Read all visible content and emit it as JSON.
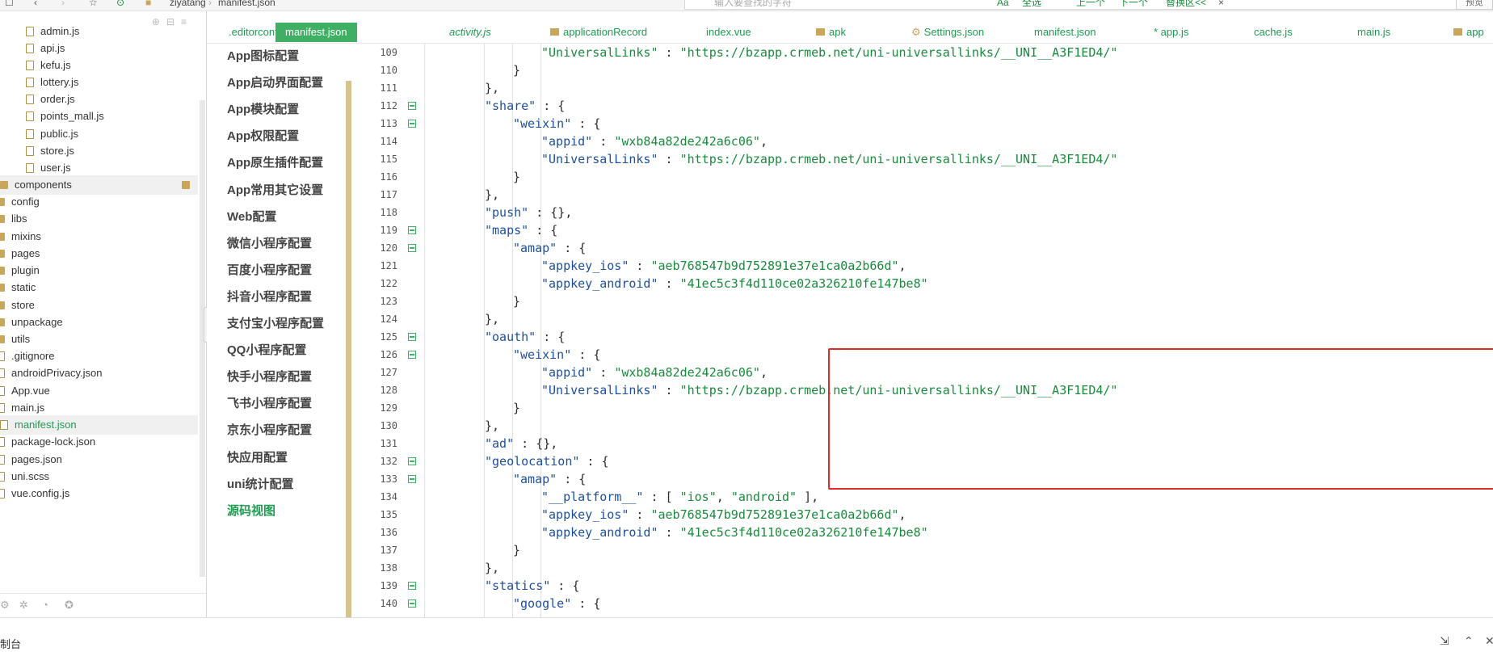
{
  "topbar": {
    "crumb1": "ziyatang",
    "crumb2": "manifest.json",
    "search_placeholder": "输入要查找的字符",
    "buttons": [
      "Aa",
      "全选",
      "上一个",
      "下一个",
      "替换区<<",
      "×"
    ],
    "preview": "预览"
  },
  "tree": {
    "items": [
      {
        "label": "admin.js",
        "type": "file"
      },
      {
        "label": "api.js",
        "type": "file"
      },
      {
        "label": "kefu.js",
        "type": "file"
      },
      {
        "label": "lottery.js",
        "type": "file"
      },
      {
        "label": "order.js",
        "type": "file"
      },
      {
        "label": "points_mall.js",
        "type": "file"
      },
      {
        "label": "public.js",
        "type": "file"
      },
      {
        "label": "store.js",
        "type": "file"
      },
      {
        "label": "user.js",
        "type": "file"
      },
      {
        "label": "components",
        "type": "dir"
      },
      {
        "label": "config",
        "type": "dir"
      },
      {
        "label": "libs",
        "type": "dir"
      },
      {
        "label": "mixins",
        "type": "dir"
      },
      {
        "label": "pages",
        "type": "dir"
      },
      {
        "label": "plugin",
        "type": "dir"
      },
      {
        "label": "static",
        "type": "dir"
      },
      {
        "label": "store",
        "type": "dir"
      },
      {
        "label": "unpackage",
        "type": "dir"
      },
      {
        "label": "utils",
        "type": "dir"
      },
      {
        "label": ".gitignore",
        "type": "file"
      },
      {
        "label": "androidPrivacy.json",
        "type": "file"
      },
      {
        "label": "App.vue",
        "type": "file"
      },
      {
        "label": "main.js",
        "type": "file"
      },
      {
        "label": "manifest.json",
        "type": "file"
      },
      {
        "label": "package-lock.json",
        "type": "file"
      },
      {
        "label": "pages.json",
        "type": "file"
      },
      {
        "label": "uni.scss",
        "type": "file"
      },
      {
        "label": "vue.config.js",
        "type": "file"
      }
    ]
  },
  "tabs": [
    {
      "label": ".editorconfig"
    },
    {
      "label": "manifest.json"
    },
    {
      "label": "activity.js"
    },
    {
      "label": "applicationRecord"
    },
    {
      "label": "index.vue"
    },
    {
      "label": "apk"
    },
    {
      "label": "Settings.json"
    },
    {
      "label": "manifest.json"
    },
    {
      "label": "* app.js"
    },
    {
      "label": "cache.js"
    },
    {
      "label": "main.js"
    },
    {
      "label": "app"
    }
  ],
  "config_menu": [
    "App图标配置",
    "App启动界面配置",
    "App模块配置",
    "App权限配置",
    "App原生插件配置",
    "App常用其它设置",
    "Web配置",
    "微信小程序配置",
    "百度小程序配置",
    "抖音小程序配置",
    "支付宝小程序配置",
    "QQ小程序配置",
    "快手小程序配置",
    "飞书小程序配置",
    "京东小程序配置",
    "快应用配置",
    "uni统计配置",
    "源码视图"
  ],
  "code_lines": [
    {
      "n": "109",
      "fold": false,
      "indent": 3,
      "parts": [
        [
          "s",
          "\"UniversalLinks\""
        ],
        [
          "p",
          " : "
        ],
        [
          "s",
          "\"https://bzapp.crmeb.net/uni-universallinks/__UNI__A3F1ED4/\""
        ]
      ]
    },
    {
      "n": "110",
      "fold": false,
      "indent": 2,
      "parts": [
        [
          "p",
          "}"
        ]
      ]
    },
    {
      "n": "111",
      "fold": false,
      "indent": 1,
      "parts": [
        [
          "p",
          "},"
        ]
      ]
    },
    {
      "n": "112",
      "fold": true,
      "indent": 1,
      "parts": [
        [
          "k",
          "\"share\""
        ],
        [
          "p",
          " : {"
        ]
      ]
    },
    {
      "n": "113",
      "fold": true,
      "indent": 2,
      "parts": [
        [
          "k",
          "\"weixin\""
        ],
        [
          "p",
          " : {"
        ]
      ]
    },
    {
      "n": "114",
      "fold": false,
      "indent": 3,
      "parts": [
        [
          "k",
          "\"appid\""
        ],
        [
          "p",
          " : "
        ],
        [
          "s",
          "\"wxb84a82de242a6c06\""
        ],
        [
          "p",
          ","
        ]
      ]
    },
    {
      "n": "115",
      "fold": false,
      "indent": 3,
      "parts": [
        [
          "k",
          "\"UniversalLinks\""
        ],
        [
          "p",
          " : "
        ],
        [
          "s",
          "\"https://bzapp.crmeb.net/uni-universallinks/__UNI__A3F1ED4/\""
        ]
      ]
    },
    {
      "n": "116",
      "fold": false,
      "indent": 2,
      "parts": [
        [
          "p",
          "}"
        ]
      ]
    },
    {
      "n": "117",
      "fold": false,
      "indent": 1,
      "parts": [
        [
          "p",
          "},"
        ]
      ]
    },
    {
      "n": "118",
      "fold": false,
      "indent": 1,
      "parts": [
        [
          "k",
          "\"push\""
        ],
        [
          "p",
          " : {},"
        ]
      ]
    },
    {
      "n": "119",
      "fold": true,
      "indent": 1,
      "parts": [
        [
          "k",
          "\"maps\""
        ],
        [
          "p",
          " : {"
        ]
      ]
    },
    {
      "n": "120",
      "fold": true,
      "indent": 2,
      "parts": [
        [
          "k",
          "\"amap\""
        ],
        [
          "p",
          " : {"
        ]
      ]
    },
    {
      "n": "121",
      "fold": false,
      "indent": 3,
      "parts": [
        [
          "k",
          "\"appkey_ios\""
        ],
        [
          "p",
          " : "
        ],
        [
          "s",
          "\"aeb768547b9d752891e37e1ca0a2b66d\""
        ],
        [
          "p",
          ","
        ]
      ]
    },
    {
      "n": "122",
      "fold": false,
      "indent": 3,
      "parts": [
        [
          "k",
          "\"appkey_android\""
        ],
        [
          "p",
          " : "
        ],
        [
          "s",
          "\"41ec5c3f4d110ce02a326210fe147be8\""
        ]
      ]
    },
    {
      "n": "123",
      "fold": false,
      "indent": 2,
      "parts": [
        [
          "p",
          "}"
        ]
      ]
    },
    {
      "n": "124",
      "fold": false,
      "indent": 1,
      "parts": [
        [
          "p",
          "},"
        ]
      ]
    },
    {
      "n": "125",
      "fold": true,
      "indent": 1,
      "parts": [
        [
          "k",
          "\"oauth\""
        ],
        [
          "p",
          " : {"
        ]
      ]
    },
    {
      "n": "126",
      "fold": true,
      "indent": 2,
      "parts": [
        [
          "k",
          "\"weixin\""
        ],
        [
          "p",
          " : {"
        ]
      ]
    },
    {
      "n": "127",
      "fold": false,
      "indent": 3,
      "parts": [
        [
          "k",
          "\"appid\""
        ],
        [
          "p",
          " : "
        ],
        [
          "s",
          "\"wxb84a82de242a6c06\""
        ],
        [
          "p",
          ","
        ]
      ]
    },
    {
      "n": "128",
      "fold": false,
      "indent": 3,
      "parts": [
        [
          "k",
          "\"UniversalLinks\""
        ],
        [
          "p",
          " : "
        ],
        [
          "s",
          "\"https://bzapp.crmeb.net/uni-universallinks/__UNI__A3F1ED4/\""
        ]
      ]
    },
    {
      "n": "129",
      "fold": false,
      "indent": 2,
      "parts": [
        [
          "p",
          "}"
        ]
      ]
    },
    {
      "n": "130",
      "fold": false,
      "indent": 1,
      "parts": [
        [
          "p",
          "},"
        ]
      ]
    },
    {
      "n": "131",
      "fold": false,
      "indent": 1,
      "parts": [
        [
          "k",
          "\"ad\""
        ],
        [
          "p",
          " : {},"
        ]
      ]
    },
    {
      "n": "132",
      "fold": true,
      "indent": 1,
      "parts": [
        [
          "k",
          "\"geolocation\""
        ],
        [
          "p",
          " : {"
        ]
      ]
    },
    {
      "n": "133",
      "fold": true,
      "indent": 2,
      "parts": [
        [
          "k",
          "\"amap\""
        ],
        [
          "p",
          " : {"
        ]
      ]
    },
    {
      "n": "134",
      "fold": false,
      "indent": 3,
      "parts": [
        [
          "k",
          "\"__platform__\""
        ],
        [
          "p",
          " : [ "
        ],
        [
          "s",
          "\"ios\""
        ],
        [
          "p",
          ", "
        ],
        [
          "s",
          "\"android\""
        ],
        [
          "p",
          " ],"
        ]
      ]
    },
    {
      "n": "135",
      "fold": false,
      "indent": 3,
      "parts": [
        [
          "k",
          "\"appkey_ios\""
        ],
        [
          "p",
          " : "
        ],
        [
          "s",
          "\"aeb768547b9d752891e37e1ca0a2b66d\""
        ],
        [
          "p",
          ","
        ]
      ]
    },
    {
      "n": "136",
      "fold": false,
      "indent": 3,
      "parts": [
        [
          "k",
          "\"appkey_android\""
        ],
        [
          "p",
          " : "
        ],
        [
          "s",
          "\"41ec5c3f4d110ce02a326210fe147be8\""
        ]
      ]
    },
    {
      "n": "137",
      "fold": false,
      "indent": 2,
      "parts": [
        [
          "p",
          "}"
        ]
      ]
    },
    {
      "n": "138",
      "fold": false,
      "indent": 1,
      "parts": [
        [
          "p",
          "},"
        ]
      ]
    },
    {
      "n": "139",
      "fold": true,
      "indent": 1,
      "parts": [
        [
          "k",
          "\"statics\""
        ],
        [
          "p",
          " : {"
        ]
      ]
    },
    {
      "n": "140",
      "fold": true,
      "indent": 2,
      "parts": [
        [
          "k",
          "\"google\""
        ],
        [
          "p",
          " : {"
        ]
      ]
    }
  ],
  "console": {
    "title": "制台",
    "icons": [
      "export-icon",
      "chevron-up-icon",
      "close-icon"
    ]
  },
  "colors": {
    "accent": "#3fb063",
    "highlight_box": "#e02a2a",
    "string": "#198a3c",
    "key": "#1e4f9c"
  }
}
